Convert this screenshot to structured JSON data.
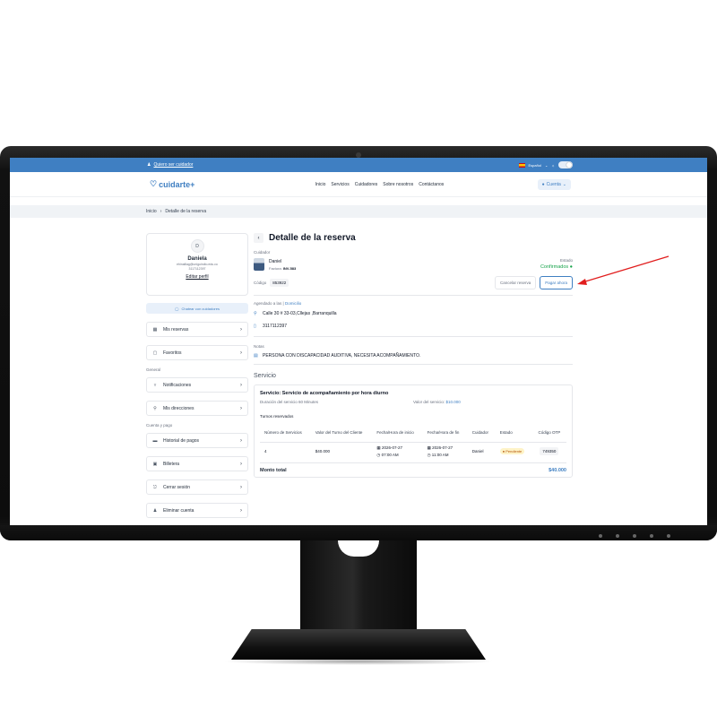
{
  "colors": {
    "brand": "#3f7fc2",
    "success": "#16a34a",
    "warning": "#b45309",
    "annotation": "#e11d1d"
  },
  "topbar": {
    "caregiver_link": "Quiero ser cuidador",
    "language": "Español"
  },
  "navbar": {
    "logo": "cuidarte+",
    "links": [
      "Inicio",
      "Servicios",
      "Cuidadores",
      "Sobre nosotros",
      "Contáctanos"
    ],
    "account": "Cuenta"
  },
  "breadcrumb": {
    "home": "Inicio",
    "current": "Detalle de la reserva"
  },
  "profile": {
    "initial": "D",
    "name": "Daniela",
    "email": "ehinalliag@uniguindio.edu.co",
    "phone": "3117112397",
    "edit": "Editar perfil"
  },
  "sidebar": {
    "chat": "Chatear con cuidadores",
    "items_main": [
      {
        "label": "Mis reservas",
        "icon": "calendar-icon"
      },
      {
        "label": "Favoritos",
        "icon": "bookmark-icon"
      }
    ],
    "section_general": "General",
    "items_general": [
      {
        "label": "Notificaciones",
        "icon": "bell-icon"
      },
      {
        "label": "Mis direcciones",
        "icon": "location-icon"
      }
    ],
    "section_account": "Cuenta y pago",
    "items_account": [
      {
        "label": "Historial de pagos",
        "icon": "card-icon"
      },
      {
        "label": "Billetera",
        "icon": "wallet-icon"
      },
      {
        "label": "Cerrar sesión",
        "icon": "logout-icon"
      },
      {
        "label": "Eliminar cuenta",
        "icon": "user-remove-icon"
      }
    ]
  },
  "detail": {
    "title": "Detalle de la reserva",
    "caregiver_label": "Cuidador",
    "caregiver_name": "Daniel",
    "invoice_label": "Factura:",
    "invoice_value": "INV-583",
    "status_label": "Estado",
    "status_value": "Confirmados",
    "code_label": "Código",
    "code_value": "853922",
    "cancel_button": "Cancelar reserva",
    "pay_button": "Pagar ahora",
    "scheduled_label": "Agendado a las",
    "scheduled_value": "Domicilio",
    "address": "Calle 30 # 33-03,Cllejas ,Barranquilla",
    "phone": "3117112397",
    "notes_label": "Notas",
    "notes": "PERSONA CON DISCAPACIDAD AUDITIVA, NECESITA ACOMPAÑAMIENTO."
  },
  "service": {
    "section_title": "Servicio",
    "name": "Servicio: Servicio de acompañamiento por hora diurno",
    "duration_label": "Duración del servicio",
    "duration_value": "60 Minutes",
    "value_label": "Valor del servicio:",
    "value_value": "$10.000",
    "shifts_label": "Turnos reservados",
    "columns": [
      "Número de Servicios",
      "Valor del Turno del Cliente",
      "Fecha/Hora de inicio",
      "Fecha/Hora de fin",
      "Cuidador",
      "Estado",
      "Código OTP"
    ],
    "row": {
      "count": "4",
      "value": "$40.000",
      "start_date": "2026-07-27",
      "start_time": "07:00 AM",
      "end_date": "2026-07-27",
      "end_time": "11:00 AM",
      "caregiver": "Daniel",
      "status": "Pendiente",
      "otp": "749350"
    },
    "total_label": "Monto total",
    "total_value": "$40.000"
  }
}
